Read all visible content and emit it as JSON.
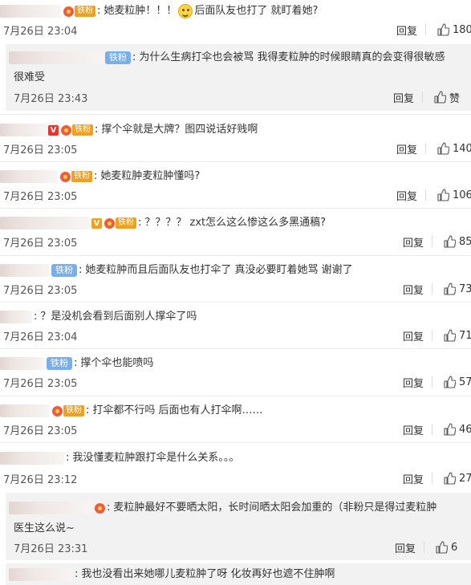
{
  "comments": [
    {
      "verified": "",
      "fan_icon": true,
      "fan_tag": "铁粉",
      "fan_pill": "",
      "text_a": "她麦粒肿！！！",
      "emoji": true,
      "text_b": "后面队友也打了 就盯着她?",
      "time": "7月26日 23:04",
      "reply": "回复",
      "likes": "180"
    },
    {
      "verified": "",
      "fan_icon": false,
      "fan_tag": "",
      "fan_pill": "铁粉",
      "text_a": "为什么生病打伞也会被骂 我得麦粒肿的时候眼睛真的会变得很敏感",
      "text_line2": "很难受",
      "time": "7月26日 23:43",
      "reply": "回复",
      "likes": "赞"
    },
    {
      "verified": "V",
      "fan_icon": true,
      "fan_tag": "铁粉",
      "fan_pill": "",
      "text_a": "撑个伞就是大牌？图四说话好贱啊",
      "time": "7月26日 23:05",
      "reply": "回复",
      "likes": "140"
    },
    {
      "verified": "",
      "fan_icon": true,
      "fan_tag": "铁粉",
      "fan_pill": "",
      "text_a": "她麦粒肿麦粒肿懂吗?",
      "time": "7月26日 23:05",
      "reply": "回复",
      "likes": "106"
    },
    {
      "verified": "V",
      "fan_icon": true,
      "fan_tag": "铁粉",
      "fan_pill": "",
      "text_a": "？？？？ zxt怎么这么惨这么多黑通稿?",
      "time": "7月26日 23:05",
      "reply": "回复",
      "likes": "85"
    },
    {
      "verified": "",
      "fan_icon": false,
      "fan_tag": "",
      "fan_pill": "铁粉",
      "text_a": "她麦粒肿而且后面队友也打伞了 真没必要盯着她骂 谢谢了",
      "time": "7月26日 23:05",
      "reply": "回复",
      "likes": "73"
    },
    {
      "verified": "",
      "fan_icon": false,
      "fan_tag": "",
      "fan_pill": "",
      "text_a": "？是没机会看到后面别人撑伞了吗",
      "time": "7月26日 23:04",
      "reply": "回复",
      "likes": "71"
    },
    {
      "verified": "",
      "fan_icon": false,
      "fan_tag": "",
      "fan_pill": "铁粉",
      "text_a": "撑个伞也能喷吗",
      "time": "7月26日 23:05",
      "reply": "回复",
      "likes": "57"
    },
    {
      "verified": "",
      "fan_icon": true,
      "fan_tag": "铁粉",
      "fan_pill": "",
      "text_a": "打伞都不行吗 后面也有人打伞啊……",
      "time": "7月26日 23:05",
      "reply": "回复",
      "likes": "46"
    },
    {
      "verified": "",
      "fan_icon": false,
      "fan_tag": "",
      "fan_pill": "",
      "text_a": "我没懂麦粒肿跟打伞是什么关系。。。",
      "time": "7月26日 23:12",
      "reply": "回复",
      "likes": "27"
    },
    {
      "verified": "",
      "fan_icon": true,
      "fan_tag": "",
      "fan_pill": "",
      "text_a": "麦粒肿最好不要晒太阳，长时间晒太阳会加重的（非粉只是得过麦粒肿",
      "text_line2": "医生这么说~",
      "time": "7月26日 23:31",
      "reply": "回复",
      "likes": "6"
    },
    {
      "verified": "",
      "fan_icon": false,
      "fan_tag": "",
      "fan_pill": "",
      "text_a": "我也没看出来她哪儿麦粒肿了呀 化妆再好也遮不住肿啊",
      "time": "",
      "reply": "",
      "likes": ""
    }
  ]
}
